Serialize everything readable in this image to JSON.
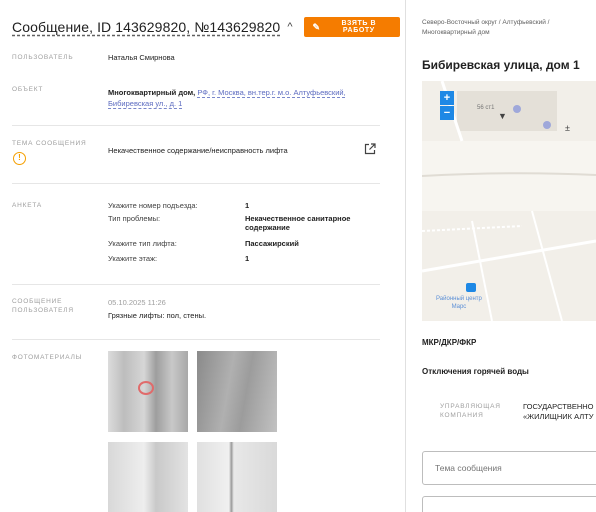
{
  "header": {
    "title": "Сообщение, ID 143629820, №143629820",
    "caret": "^",
    "take_button": "Взять в работу"
  },
  "fields": {
    "user_label": "Пользователь",
    "user_value": "Наталья Смирнова",
    "object_label": "Объект",
    "object_prefix": "Многоквартирный дом,",
    "object_link_1": "РФ, г. Москва, вн.тер.г. м.о. Алтуфьевский,",
    "object_link_2": "Бибиревская ул., д. 1",
    "topic_label": "Тема сообщения",
    "topic_value": "Некачественное содержание/неисправность лифта",
    "form_label": "Анкета",
    "form": [
      {
        "q": "Укажите номер подъезда:",
        "a": "1"
      },
      {
        "q": "Тип проблемы:",
        "a": "Некачественное санитарное содержание"
      },
      {
        "q": "Укажите тип лифта:",
        "a": "Пассажирский"
      },
      {
        "q": "Укажите этаж:",
        "a": "1"
      }
    ],
    "message_label_1": "Сообщение",
    "message_label_2": "пользователя",
    "message_date": "05.10.2025 11:26",
    "message_text": "Грязные лифты: пол, стены.",
    "photos_label": "Фотоматериалы"
  },
  "side": {
    "breadcrumb_1": "Северо-Восточный округ / Алтуфьевский /",
    "breadcrumb_2": "Многоквартирный дом",
    "address": "Бибиревская улица, дом 1",
    "map": {
      "zoom_in": "+",
      "zoom_out": "−",
      "building_label": "56 ст1",
      "poi_label_1": "Районный центр",
      "poi_label_2": "Марс"
    },
    "mkr": "МКР/ДКР/ФКР",
    "hot_water": "Отключения горячей воды",
    "uk_label_1": "Управляющая",
    "uk_label_2": "компания",
    "uk_value_1": "ГОСУДАРСТВЕННО",
    "uk_value_2": "«ЖИЛИЩНИК АЛТУ",
    "topic_placeholder": "Тема сообщения"
  }
}
